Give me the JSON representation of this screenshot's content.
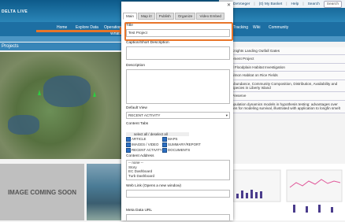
{
  "header": {
    "logo": "DELTA LIVE",
    "user": "Sarah DeVoeger",
    "basket": "(0) My Basket",
    "help": "Help",
    "search_label": "Search",
    "search_btn": "Search"
  },
  "nav": [
    "Home",
    "Explore Data",
    "Operations",
    "Tracking",
    "Wiki",
    "Community",
    "What I"
  ],
  "projects_label": "Projects",
  "right_list": [
    "Knights Landing Outfall Gates",
    "ement Project",
    "d Floodplain Habitat Investigation",
    "almon Habitat on Rice Fields",
    "Abundance, Community Composition, Distribution, Availability and\nSpecies in Liberty Island",
    "Preserve",
    "opulation dynamics models in hypothesis testing: advantages over\nons for modeling survival, illustrated with application to longfin smelt"
  ],
  "tiles": {
    "coming_soon": "IMAGE COMING SOON"
  },
  "modal": {
    "tabs": [
      "Main",
      "Map it!",
      "Publish",
      "Organize",
      "Video Embed"
    ],
    "title_label": "Title",
    "title_value": "Test Project",
    "caption_label": "Caption/Short Description",
    "description_label": "Description",
    "default_view_label": "Default View",
    "default_view_value": "RECENT ACTIVITY",
    "content_tabs_label": "Content Tabs",
    "select_all": "select all / deselect all",
    "content_tabs": [
      "ARTICLE",
      "MAPS",
      "IMAGES / VIDEO",
      "SUMMARY/REPORT",
      "RECENT ACTIVITY",
      "DOCUMENTS"
    ],
    "content_address_label": "Content Address",
    "content_address_options": [
      "-- none --",
      "Story",
      "EC Dashboard",
      "Turb Dashboard"
    ],
    "web_link_label": "Web Link (Opens a new window)",
    "meta_url_label": "Meta Data URL"
  }
}
